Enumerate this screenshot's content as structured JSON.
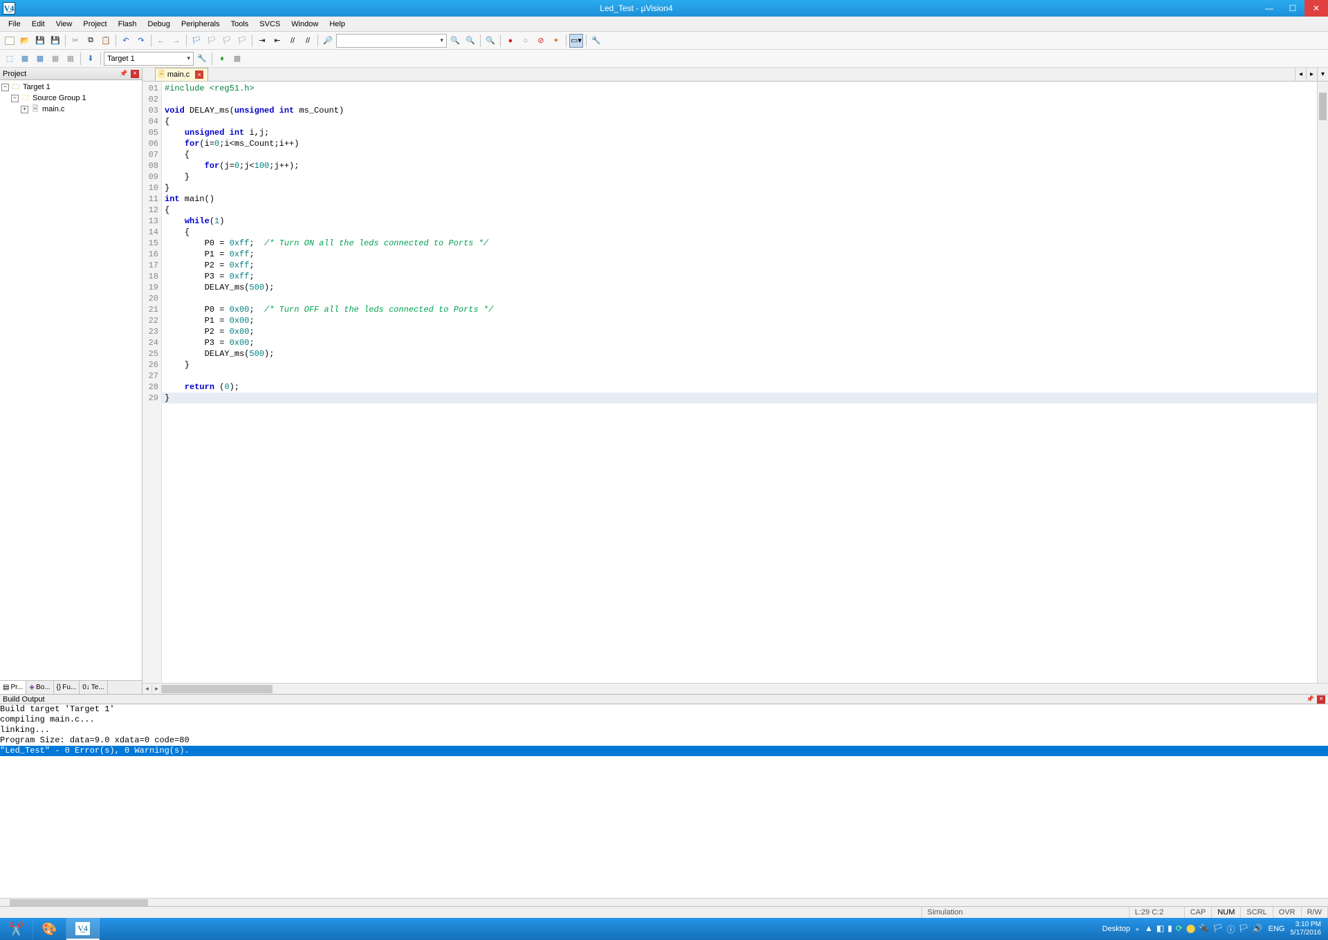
{
  "window": {
    "title": "Led_Test  - µVision4"
  },
  "menu": [
    "File",
    "Edit",
    "View",
    "Project",
    "Flash",
    "Debug",
    "Peripherals",
    "Tools",
    "SVCS",
    "Window",
    "Help"
  ],
  "toolbar2": {
    "target": "Target 1"
  },
  "project_panel": {
    "title": "Project",
    "tree": {
      "target": "Target 1",
      "group": "Source Group 1",
      "file": "main.c"
    },
    "tabs": [
      "Pr...",
      "Bo...",
      "Fu...",
      "Te..."
    ]
  },
  "file_tab": {
    "name": "main.c"
  },
  "code": {
    "lines": [
      {
        "n": "01",
        "t": "#include <reg51.h>",
        "cls": "pp"
      },
      {
        "n": "02",
        "t": ""
      },
      {
        "n": "03",
        "html": "<span class='kw'>void</span> DELAY_ms(<span class='kw'>unsigned</span> <span class='kw'>int</span> ms_Count)"
      },
      {
        "n": "04",
        "t": "{"
      },
      {
        "n": "05",
        "html": "    <span class='kw'>unsigned</span> <span class='kw'>int</span> i,j;"
      },
      {
        "n": "06",
        "html": "    <span class='kw'>for</span>(i=<span class='num'>0</span>;i&lt;ms_Count;i++)"
      },
      {
        "n": "07",
        "t": "    {"
      },
      {
        "n": "08",
        "html": "        <span class='kw'>for</span>(j=<span class='num'>0</span>;j&lt;<span class='num'>100</span>;j++);"
      },
      {
        "n": "09",
        "t": "    }"
      },
      {
        "n": "10",
        "t": "}"
      },
      {
        "n": "11",
        "html": "<span class='kw'>int</span> main()"
      },
      {
        "n": "12",
        "t": "{"
      },
      {
        "n": "13",
        "html": "    <span class='kw'>while</span>(<span class='num'>1</span>)"
      },
      {
        "n": "14",
        "t": "    {"
      },
      {
        "n": "15",
        "html": "        P0 = <span class='num'>0xff</span>;  <span class='cm'>/* Turn ON all the leds connected to Ports */</span>"
      },
      {
        "n": "16",
        "html": "        P1 = <span class='num'>0xff</span>;"
      },
      {
        "n": "17",
        "html": "        P2 = <span class='num'>0xff</span>;"
      },
      {
        "n": "18",
        "html": "        P3 = <span class='num'>0xff</span>;"
      },
      {
        "n": "19",
        "html": "        DELAY_ms(<span class='num'>500</span>);"
      },
      {
        "n": "20",
        "t": ""
      },
      {
        "n": "21",
        "html": "        P0 = <span class='num'>0x00</span>;  <span class='cm'>/* Turn OFF all the leds connected to Ports */</span>"
      },
      {
        "n": "22",
        "html": "        P1 = <span class='num'>0x00</span>;"
      },
      {
        "n": "23",
        "html": "        P2 = <span class='num'>0x00</span>;"
      },
      {
        "n": "24",
        "html": "        P3 = <span class='num'>0x00</span>;"
      },
      {
        "n": "25",
        "html": "        DELAY_ms(<span class='num'>500</span>);"
      },
      {
        "n": "26",
        "t": "    }"
      },
      {
        "n": "27",
        "t": ""
      },
      {
        "n": "28",
        "html": "    <span class='kw'>return</span> (<span class='num'>0</span>);"
      },
      {
        "n": "29",
        "t": "}"
      }
    ],
    "highlight_line": 29
  },
  "build": {
    "title": "Build Output",
    "lines": [
      {
        "t": "Build target 'Target 1'"
      },
      {
        "t": "compiling main.c..."
      },
      {
        "t": "linking..."
      },
      {
        "t": "Program Size: data=9.0 xdata=0 code=80"
      },
      {
        "t": "\"Led_Test\" - 0 Error(s), 0 Warning(s).",
        "hl": true
      }
    ]
  },
  "statusbar": {
    "mode": "Simulation",
    "cursor": "L:29 C:2",
    "flags": [
      "CAP",
      "NUM",
      "SCRL",
      "OVR",
      "R/W"
    ]
  },
  "taskbar": {
    "desktop": "Desktop",
    "lang": "ENG",
    "time": "3:10 PM",
    "date": "5/17/2016"
  }
}
